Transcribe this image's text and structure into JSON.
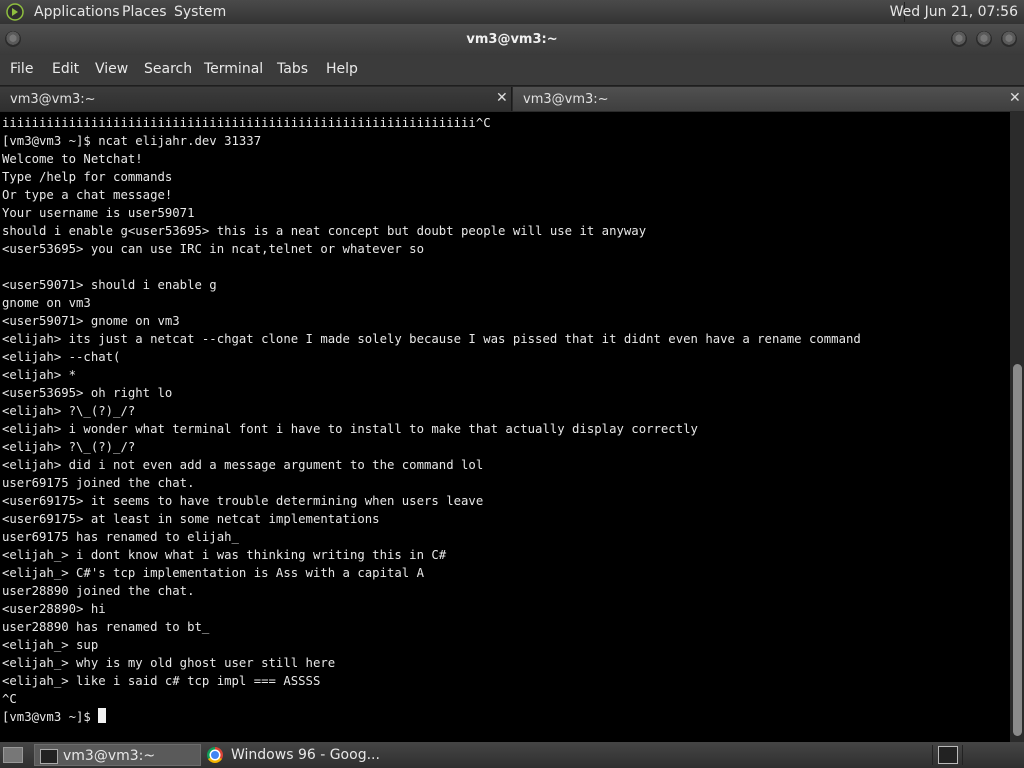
{
  "top_panel": {
    "menus": [
      "Applications",
      "Places",
      "System"
    ],
    "clock": "Wed Jun 21, 07:56"
  },
  "window": {
    "title": "vm3@vm3:~",
    "menu": [
      "File",
      "Edit",
      "View",
      "Search",
      "Terminal",
      "Tabs",
      "Help"
    ],
    "tabs": [
      {
        "label": "vm3@vm3:~",
        "active": true
      },
      {
        "label": "vm3@vm3:~",
        "active": false
      }
    ]
  },
  "terminal": {
    "lines": [
      "iiiiiiiiiiiiiiiiiiiiiiiiiiiiiiiiiiiiiiiiiiiiiiiiiiiiiiiiiiiiiiii^C",
      "[vm3@vm3 ~]$ ncat elijahr.dev 31337",
      "Welcome to Netchat!",
      "Type /help for commands",
      "Or type a chat message!",
      "Your username is user59071",
      "should i enable g<user53695> this is a neat concept but doubt people will use it anyway",
      "<user53695> you can use IRC in ncat,telnet or whatever so",
      "",
      "<user59071> should i enable g",
      "gnome on vm3",
      "<user59071> gnome on vm3",
      "<elijah> its just a netcat --chgat clone I made solely because I was pissed that it didnt even have a rename command",
      "<elijah> --chat(",
      "<elijah> *",
      "<user53695> oh right lo",
      "<elijah> ?\\_(?)_/?",
      "<elijah> i wonder what terminal font i have to install to make that actually display correctly",
      "<elijah> ?\\_(?)_/?",
      "<elijah> did i not even add a message argument to the command lol",
      "user69175 joined the chat.",
      "<user69175> it seems to have trouble determining when users leave",
      "<user69175> at least in some netcat implementations",
      "user69175 has renamed to elijah_",
      "<elijah_> i dont know what i was thinking writing this in C#",
      "<elijah_> C#'s tcp implementation is Ass with a capital A",
      "user28890 joined the chat.",
      "<user28890> hi",
      "user28890 has renamed to bt_",
      "<elijah_> sup",
      "<elijah_> why is my old ghost user still here",
      "<elijah_> like i said c# tcp impl === ASSSS",
      "^C"
    ],
    "prompt": "[vm3@vm3 ~]$ "
  },
  "taskbar": {
    "tasks": [
      {
        "label": "vm3@vm3:~",
        "icon": "terminal-icon"
      },
      {
        "label": "Windows 96 - Goog...",
        "icon": "chrome-icon"
      }
    ]
  }
}
